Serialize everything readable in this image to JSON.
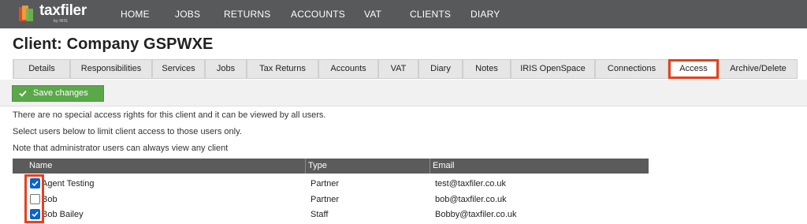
{
  "app": {
    "logo_text": "taxfiler",
    "logo_sub": "by IRIS",
    "brand_colors": {
      "header_bg": "#58595b",
      "highlight": "#e8401c",
      "save_green": "#5ba84b",
      "checkbox_blue": "#0a63c9"
    }
  },
  "nav": {
    "items": [
      "HOME",
      "JOBS",
      "RETURNS",
      "ACCOUNTS",
      "VAT",
      "CLIENTS",
      "DIARY"
    ]
  },
  "page": {
    "title": "Client: Company GSPWXE"
  },
  "tabs": {
    "items": [
      "Details",
      "Responsibilities",
      "Services",
      "Jobs",
      "Tax Returns",
      "Accounts",
      "VAT",
      "Diary",
      "Notes",
      "IRIS OpenSpace",
      "Connections",
      "Access",
      "Archive/Delete"
    ],
    "active": "Access"
  },
  "toolbar": {
    "save_label": "Save changes",
    "save_icon": "check-icon"
  },
  "info": {
    "line1": "There are no special access rights for this client and it can be viewed by all users.",
    "line2": "Select users below to limit client access to those users only.",
    "line3": "Note that administrator users can always view any client"
  },
  "users_table": {
    "headers": [
      "Name",
      "Type",
      "Email"
    ],
    "rows": [
      {
        "checked": true,
        "name": "Agent Testing",
        "type": "Partner",
        "email": "test@taxfiler.co.uk"
      },
      {
        "checked": false,
        "name": "Bob",
        "type": "Partner",
        "email": "bob@taxfiler.co.uk"
      },
      {
        "checked": true,
        "name": "Bob Bailey",
        "type": "Staff",
        "email": "Bobby@taxfiler.co.uk"
      }
    ]
  }
}
